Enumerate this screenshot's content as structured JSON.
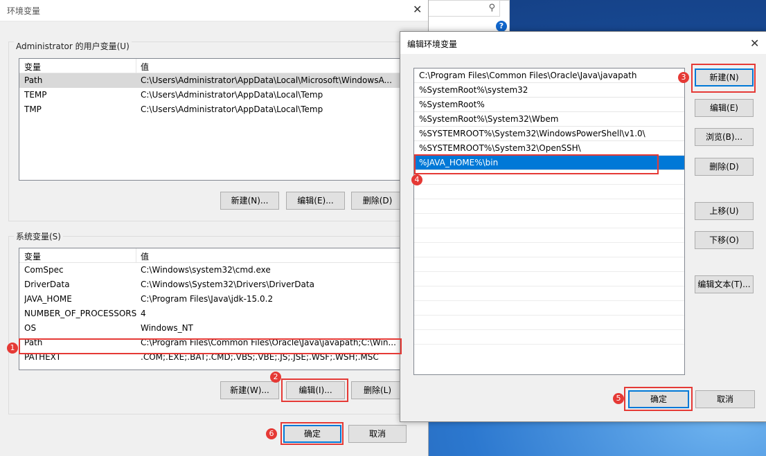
{
  "env_dialog": {
    "title": "环境变量",
    "user_section_label": "Administrator 的用户变量(U)",
    "system_section_label": "系统变量(S)",
    "col_var": "变量",
    "col_value": "值",
    "user_vars": [
      {
        "name": "Path",
        "value": "C:\\Users\\Administrator\\AppData\\Local\\Microsoft\\WindowsA..."
      },
      {
        "name": "TEMP",
        "value": "C:\\Users\\Administrator\\AppData\\Local\\Temp"
      },
      {
        "name": "TMP",
        "value": "C:\\Users\\Administrator\\AppData\\Local\\Temp"
      }
    ],
    "system_vars": [
      {
        "name": "ComSpec",
        "value": "C:\\Windows\\system32\\cmd.exe"
      },
      {
        "name": "DriverData",
        "value": "C:\\Windows\\System32\\Drivers\\DriverData"
      },
      {
        "name": "JAVA_HOME",
        "value": "C:\\Program Files\\Java\\jdk-15.0.2"
      },
      {
        "name": "NUMBER_OF_PROCESSORS",
        "value": "4"
      },
      {
        "name": "OS",
        "value": "Windows_NT"
      },
      {
        "name": "Path",
        "value": "C:\\Program Files\\Common Files\\Oracle\\Java\\javapath;C:\\Win..."
      },
      {
        "name": "PATHEXT",
        "value": ".COM;.EXE;.BAT;.CMD;.VBS;.VBE;.JS;.JSE;.WSF;.WSH;.MSC"
      }
    ],
    "user_buttons": {
      "new": "新建(N)...",
      "edit": "编辑(E)...",
      "delete": "删除(D)"
    },
    "system_buttons": {
      "new": "新建(W)...",
      "edit": "编辑(I)...",
      "delete": "删除(L)"
    },
    "ok": "确定",
    "cancel": "取消"
  },
  "edit_dialog": {
    "title": "编辑环境变量",
    "entries": [
      "C:\\Program Files\\Common Files\\Oracle\\Java\\javapath",
      "%SystemRoot%\\system32",
      "%SystemRoot%",
      "%SystemRoot%\\System32\\Wbem",
      "%SYSTEMROOT%\\System32\\WindowsPowerShell\\v1.0\\",
      "%SYSTEMROOT%\\System32\\OpenSSH\\",
      "%JAVA_HOME%\\bin"
    ],
    "selected_index": 6,
    "buttons": {
      "new": "新建(N)",
      "edit": "编辑(E)",
      "browse": "浏览(B)...",
      "delete": "删除(D)",
      "up": "上移(U)",
      "down": "下移(O)",
      "edit_text": "编辑文本(T)..."
    },
    "ok": "确定",
    "cancel": "取消"
  },
  "annotations": [
    "1",
    "2",
    "3",
    "4",
    "5",
    "6"
  ],
  "colors": {
    "highlight": "#e53935",
    "selection": "#0078d7"
  }
}
